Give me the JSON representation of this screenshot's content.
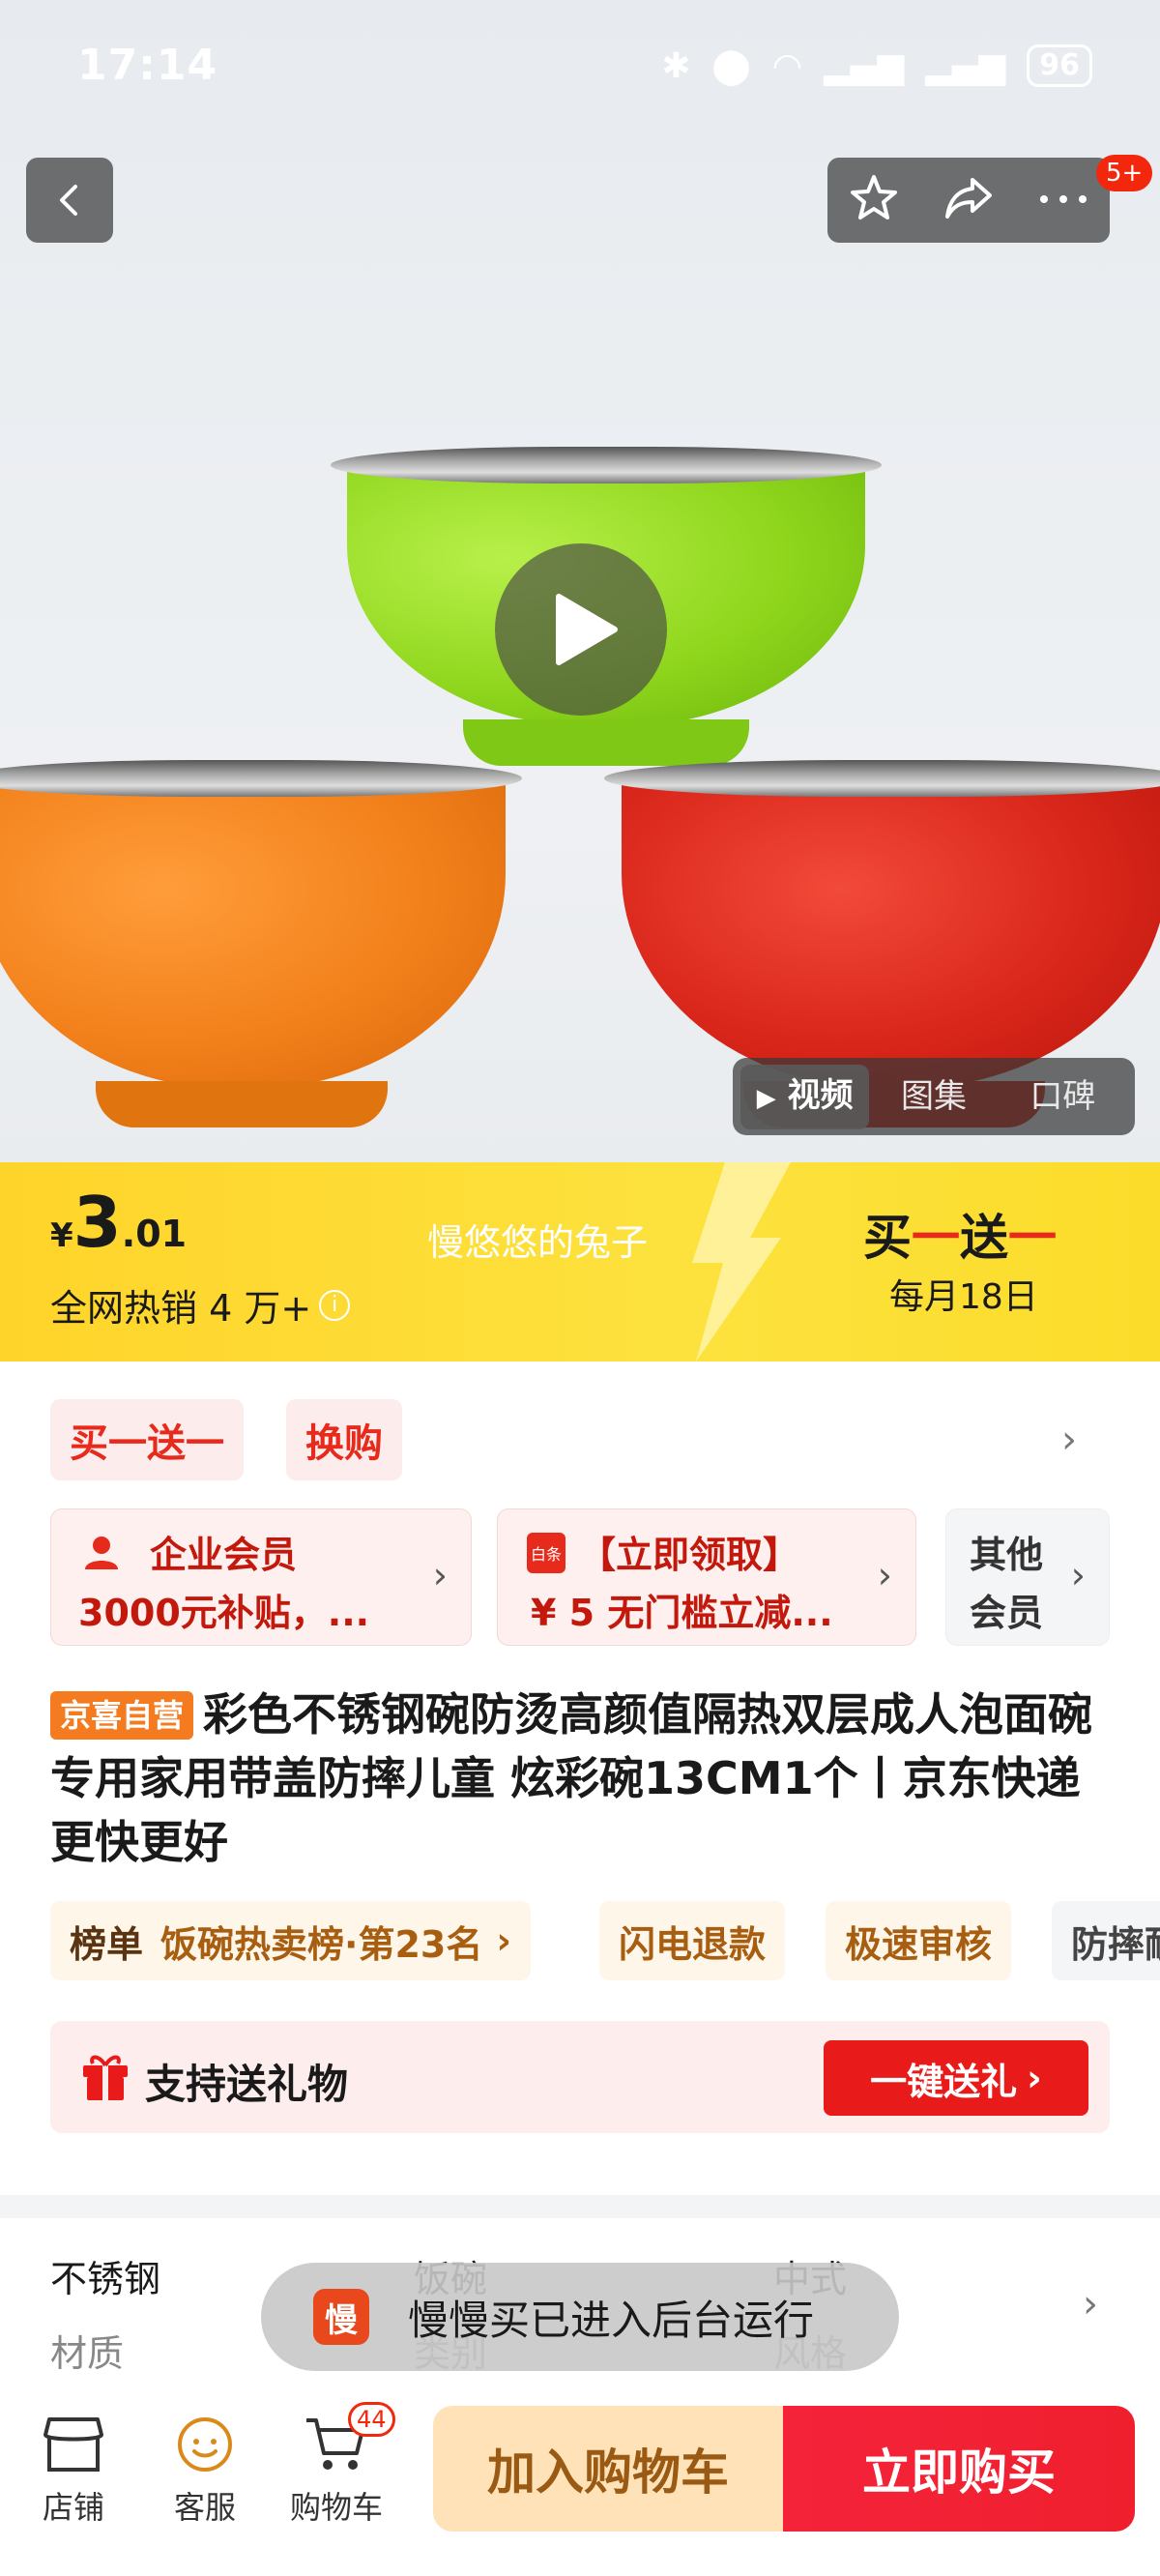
{
  "status_bar": {
    "time": "17:14",
    "battery": "96"
  },
  "header": {
    "message_badge": "5+"
  },
  "media": {
    "tabs": [
      "视频",
      "图集",
      "口碑"
    ],
    "active_tab": "视频"
  },
  "price_banner": {
    "currency": "¥",
    "price_int": "3",
    "price_dec": ".01",
    "sales": "全网热销 4 万+",
    "shop_name": "慢悠悠的兔子",
    "promo_title": "买一送一",
    "promo_date": "每月18日"
  },
  "promo_tags": [
    "买一送一",
    "换购"
  ],
  "coupons": [
    {
      "line1": "企业会员",
      "line2": "3000元补贴，..."
    },
    {
      "icon_text": "白条",
      "line1": "【立即领取】",
      "line2": "¥ 5 无门槛立减..."
    },
    {
      "line1": "其他",
      "line2": "会员"
    }
  ],
  "product": {
    "badge": "京喜自营",
    "title": "彩色不锈钢碗防烫高颜值隔热双层成人泡面碗专用家用带盖防摔儿童 炫彩碗13CM1个丨京东快递 更快更好"
  },
  "chips": {
    "rank_key": "榜单",
    "rank_value": "饭碗热卖榜·第23名",
    "items": [
      "闪电退款",
      "极速审核",
      "防摔耐"
    ]
  },
  "gift": {
    "label": "支持送礼物",
    "button": "一键送礼"
  },
  "specs": [
    {
      "value": "不锈钢",
      "key": "材质"
    },
    {
      "value": "饭碗",
      "key": "类别"
    },
    {
      "value": "中式",
      "key": "风格"
    }
  ],
  "toast": {
    "logo": "慢",
    "text": "慢慢买已进入后台运行"
  },
  "bottom_nav": {
    "items": [
      "店铺",
      "客服",
      "购物车"
    ],
    "cart_count": "44",
    "add_to_cart": "加入购物车",
    "buy_now": "立即购买"
  },
  "colors": {
    "accent_red": "#e91a1a",
    "banner_yellow": "#ffd42a",
    "cart_btn": "#ffe2b8"
  }
}
